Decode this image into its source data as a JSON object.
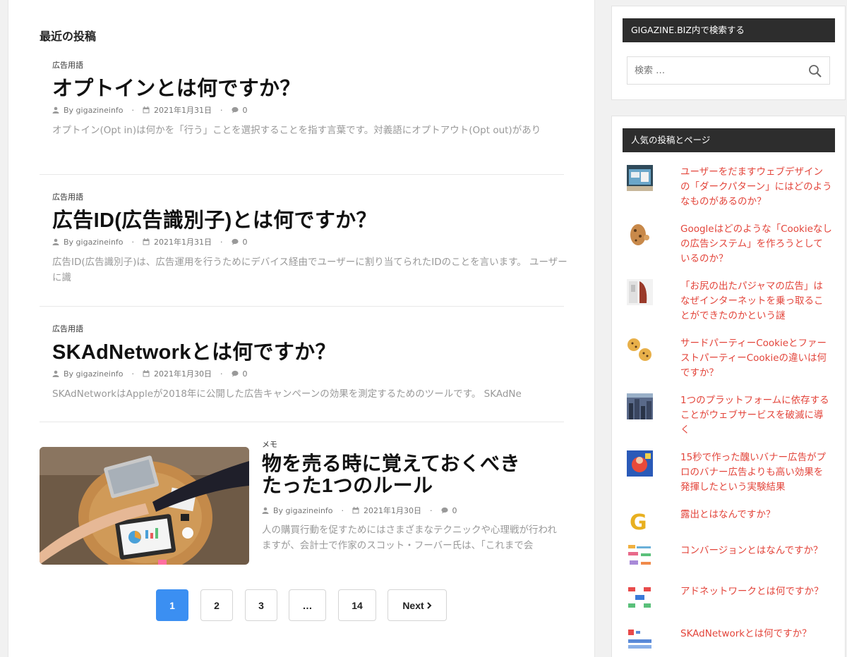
{
  "main": {
    "section_title": "最近の投稿",
    "posts": [
      {
        "category": "広告用語",
        "title": "オプトインとは何ですか？",
        "author": "By gigazineinfo",
        "date": "2021年1月31日",
        "comments": "0",
        "excerpt": "オプトイン(Opt in)は何かを「行う」ことを選択することを指す言葉です。対義語にオプトアウト(Opt out)があり"
      },
      {
        "category": "広告用語",
        "title": "広告ID(広告識別子)とは何ですか？",
        "author": "By gigazineinfo",
        "date": "2021年1月31日",
        "comments": "0",
        "excerpt": "広告ID(広告識別子)は、広告運用を行うためにデバイス経由でユーザーに割り当てられたIDのことを言います。 ユーザーに識"
      },
      {
        "category": "広告用語",
        "title": "SKAdNetworkとは何ですか？",
        "author": "By gigazineinfo",
        "date": "2021年1月30日",
        "comments": "0",
        "excerpt": "SKAdNetworkはAppleが2018年に公開した広告キャンペーンの効果を測定するためのツールです。 SKAdNe"
      },
      {
        "category": "メモ",
        "title_line1": "物を売る時に覚えておくべき",
        "title_line2": "たった1つのルール",
        "author": "By gigazineinfo",
        "date": "2021年1月30日",
        "comments": "0",
        "excerpt": "人の購買行動を促すためにはさまざまなテクニックや心理戦が行われますが、会計士で作家のスコット・フーバー氏は、「これまで会"
      }
    ],
    "pagination": [
      "1",
      "2",
      "3",
      "…",
      "14",
      "Next"
    ]
  },
  "sidebar": {
    "search_heading": "GIGAZINE.BIZ内で検索する",
    "search_placeholder": "検索 …",
    "popular_heading": "人気の投稿とページ",
    "popular": [
      {
        "title": "ユーザーをだますウェブデザインの「ダークパターン」にはどのようなものがあるのか？",
        "icon": "web-screenshot"
      },
      {
        "title": "Googleはどのような「Cookieなしの広告システム」を作ろうとしているのか？",
        "icon": "cookie-monster"
      },
      {
        "title": "「お尻の出たパジャマの広告」はなぜインターネットを乗っ取ることができたのかという謎",
        "icon": "pajama-photo"
      },
      {
        "title": "サードパーティーCookieとファーストパーティーCookieの違いは何ですか？",
        "icon": "cookies"
      },
      {
        "title": "1つのプラットフォームに依存することがウェブサービスを破滅に導く",
        "icon": "city-photo"
      },
      {
        "title": "15秒で作った醜いバナー広告がプロのバナー広告よりも高い効果を発揮したという実験結果",
        "icon": "banner-ad"
      },
      {
        "title": "露出とはなんですか？",
        "icon": "letter-g"
      },
      {
        "title": "コンバージョンとはなんですか？",
        "icon": "diagram"
      },
      {
        "title": "アドネットワークとは何ですか？",
        "icon": "network-diagram"
      },
      {
        "title": "SKAdNetworkとは何ですか？",
        "icon": "sk-diagram"
      }
    ]
  }
}
